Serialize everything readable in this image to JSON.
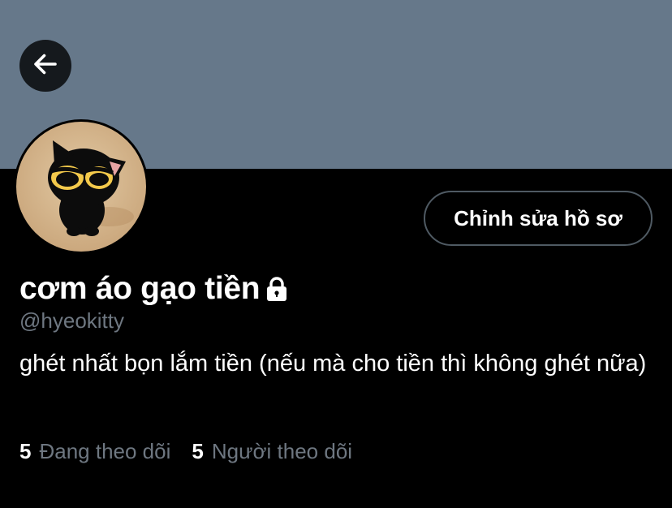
{
  "header": {
    "banner_color": "#66788a",
    "back_icon": "arrow-left-icon"
  },
  "profile": {
    "avatar_icon": "black-cat-avatar",
    "edit_button_label": "Chỉnh sửa hồ sơ",
    "display_name": "cơm áo gạo tiền",
    "protected_icon": "lock-icon",
    "handle": "@hyeokitty",
    "bio": "ghét nhất bọn lắm tiền (nếu mà cho tiền thì không ghét nữa)"
  },
  "stats": {
    "following_count": "5",
    "following_label": "Đang theo dõi",
    "followers_count": "5",
    "followers_label": "Người theo dõi"
  },
  "colors": {
    "background": "#000000",
    "secondary_text": "#6e7781",
    "button_border": "#4f5a63"
  }
}
